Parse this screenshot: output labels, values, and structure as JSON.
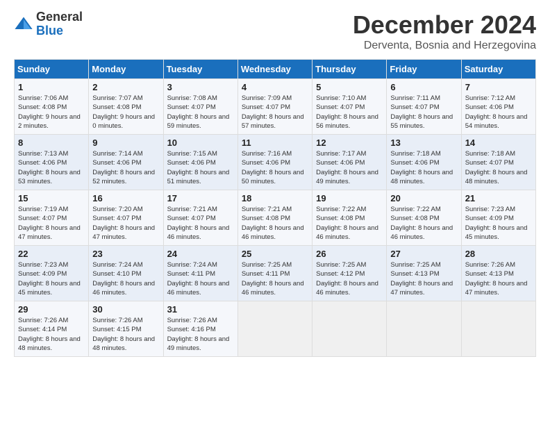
{
  "header": {
    "logo_general": "General",
    "logo_blue": "Blue",
    "month_title": "December 2024",
    "location": "Derventa, Bosnia and Herzegovina"
  },
  "days_of_week": [
    "Sunday",
    "Monday",
    "Tuesday",
    "Wednesday",
    "Thursday",
    "Friday",
    "Saturday"
  ],
  "weeks": [
    [
      {
        "day": "1",
        "sunrise": "7:06 AM",
        "sunset": "4:08 PM",
        "daylight": "9 hours and 2 minutes."
      },
      {
        "day": "2",
        "sunrise": "7:07 AM",
        "sunset": "4:08 PM",
        "daylight": "9 hours and 0 minutes."
      },
      {
        "day": "3",
        "sunrise": "7:08 AM",
        "sunset": "4:07 PM",
        "daylight": "8 hours and 59 minutes."
      },
      {
        "day": "4",
        "sunrise": "7:09 AM",
        "sunset": "4:07 PM",
        "daylight": "8 hours and 57 minutes."
      },
      {
        "day": "5",
        "sunrise": "7:10 AM",
        "sunset": "4:07 PM",
        "daylight": "8 hours and 56 minutes."
      },
      {
        "day": "6",
        "sunrise": "7:11 AM",
        "sunset": "4:07 PM",
        "daylight": "8 hours and 55 minutes."
      },
      {
        "day": "7",
        "sunrise": "7:12 AM",
        "sunset": "4:06 PM",
        "daylight": "8 hours and 54 minutes."
      }
    ],
    [
      {
        "day": "8",
        "sunrise": "7:13 AM",
        "sunset": "4:06 PM",
        "daylight": "8 hours and 53 minutes."
      },
      {
        "day": "9",
        "sunrise": "7:14 AM",
        "sunset": "4:06 PM",
        "daylight": "8 hours and 52 minutes."
      },
      {
        "day": "10",
        "sunrise": "7:15 AM",
        "sunset": "4:06 PM",
        "daylight": "8 hours and 51 minutes."
      },
      {
        "day": "11",
        "sunrise": "7:16 AM",
        "sunset": "4:06 PM",
        "daylight": "8 hours and 50 minutes."
      },
      {
        "day": "12",
        "sunrise": "7:17 AM",
        "sunset": "4:06 PM",
        "daylight": "8 hours and 49 minutes."
      },
      {
        "day": "13",
        "sunrise": "7:18 AM",
        "sunset": "4:06 PM",
        "daylight": "8 hours and 48 minutes."
      },
      {
        "day": "14",
        "sunrise": "7:18 AM",
        "sunset": "4:07 PM",
        "daylight": "8 hours and 48 minutes."
      }
    ],
    [
      {
        "day": "15",
        "sunrise": "7:19 AM",
        "sunset": "4:07 PM",
        "daylight": "8 hours and 47 minutes."
      },
      {
        "day": "16",
        "sunrise": "7:20 AM",
        "sunset": "4:07 PM",
        "daylight": "8 hours and 47 minutes."
      },
      {
        "day": "17",
        "sunrise": "7:21 AM",
        "sunset": "4:07 PM",
        "daylight": "8 hours and 46 minutes."
      },
      {
        "day": "18",
        "sunrise": "7:21 AM",
        "sunset": "4:08 PM",
        "daylight": "8 hours and 46 minutes."
      },
      {
        "day": "19",
        "sunrise": "7:22 AM",
        "sunset": "4:08 PM",
        "daylight": "8 hours and 46 minutes."
      },
      {
        "day": "20",
        "sunrise": "7:22 AM",
        "sunset": "4:08 PM",
        "daylight": "8 hours and 46 minutes."
      },
      {
        "day": "21",
        "sunrise": "7:23 AM",
        "sunset": "4:09 PM",
        "daylight": "8 hours and 45 minutes."
      }
    ],
    [
      {
        "day": "22",
        "sunrise": "7:23 AM",
        "sunset": "4:09 PM",
        "daylight": "8 hours and 45 minutes."
      },
      {
        "day": "23",
        "sunrise": "7:24 AM",
        "sunset": "4:10 PM",
        "daylight": "8 hours and 46 minutes."
      },
      {
        "day": "24",
        "sunrise": "7:24 AM",
        "sunset": "4:11 PM",
        "daylight": "8 hours and 46 minutes."
      },
      {
        "day": "25",
        "sunrise": "7:25 AM",
        "sunset": "4:11 PM",
        "daylight": "8 hours and 46 minutes."
      },
      {
        "day": "26",
        "sunrise": "7:25 AM",
        "sunset": "4:12 PM",
        "daylight": "8 hours and 46 minutes."
      },
      {
        "day": "27",
        "sunrise": "7:25 AM",
        "sunset": "4:13 PM",
        "daylight": "8 hours and 47 minutes."
      },
      {
        "day": "28",
        "sunrise": "7:26 AM",
        "sunset": "4:13 PM",
        "daylight": "8 hours and 47 minutes."
      }
    ],
    [
      {
        "day": "29",
        "sunrise": "7:26 AM",
        "sunset": "4:14 PM",
        "daylight": "8 hours and 48 minutes."
      },
      {
        "day": "30",
        "sunrise": "7:26 AM",
        "sunset": "4:15 PM",
        "daylight": "8 hours and 48 minutes."
      },
      {
        "day": "31",
        "sunrise": "7:26 AM",
        "sunset": "4:16 PM",
        "daylight": "8 hours and 49 minutes."
      },
      null,
      null,
      null,
      null
    ]
  ]
}
